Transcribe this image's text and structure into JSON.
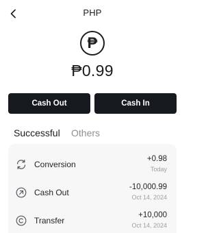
{
  "header": {
    "title": "PHP"
  },
  "wallet": {
    "currency_symbol": "₱",
    "balance": "₱0.99"
  },
  "actions": {
    "cash_out_label": "Cash Out",
    "cash_in_label": "Cash In"
  },
  "tabs": [
    {
      "label": "Successful",
      "active": true
    },
    {
      "label": "Others",
      "active": false
    }
  ],
  "transactions": [
    {
      "name": "Conversion",
      "amount": "+0.98",
      "date": "Today",
      "icon": "convert-icon"
    },
    {
      "name": "Cash Out",
      "amount": "-10,000.99",
      "date": "Oct 14, 2024",
      "icon": "arrow-up-right-circle-icon"
    },
    {
      "name": "Transfer",
      "amount": "+10,000",
      "date": "Oct 14, 2024",
      "icon": "copyright-circle-icon"
    }
  ],
  "colors": {
    "button_bg": "#16191d",
    "card_bg": "#f7f7f8",
    "muted_text": "#9a9ea4",
    "inactive_tab": "#8c9096"
  }
}
